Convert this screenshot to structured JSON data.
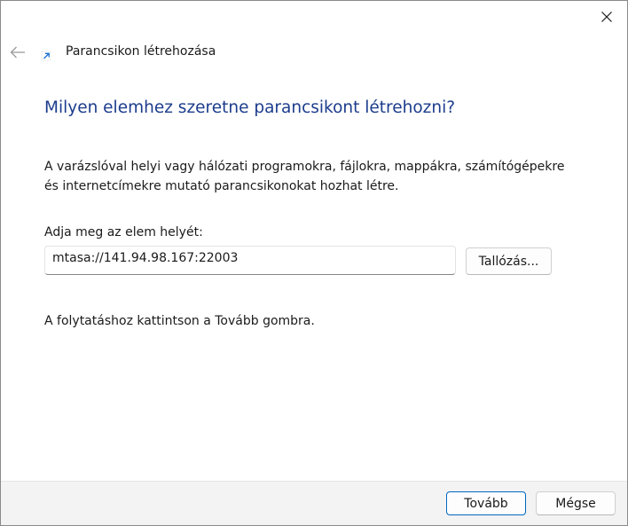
{
  "window": {
    "title": "Parancsikon létrehozása",
    "close_icon": "close-icon",
    "back_icon": "arrow-left-icon",
    "title_icon": "shortcut-arrow-icon"
  },
  "main": {
    "heading": "Milyen elemhez szeretne parancsikont létrehozni?",
    "description": "A varázslóval helyi vagy hálózati programokra, fájlokra, mappákra, számítógépekre és internetcímekre mutató parancsikonokat hozhat létre.",
    "location_label": "Adja meg az elem helyét:",
    "location_value": "mtasa://141.94.98.167:22003",
    "browse_label": "Tallózás...",
    "hint": "A folytatáshoz kattintson a Tovább gombra."
  },
  "footer": {
    "next_label": "Tovább",
    "cancel_label": "Mégse"
  },
  "colors": {
    "heading": "#1c3c8c",
    "accent_border": "#0067c0",
    "footer_bg": "#f3f3f3",
    "shortcut_icon": "#1a6fd1"
  }
}
